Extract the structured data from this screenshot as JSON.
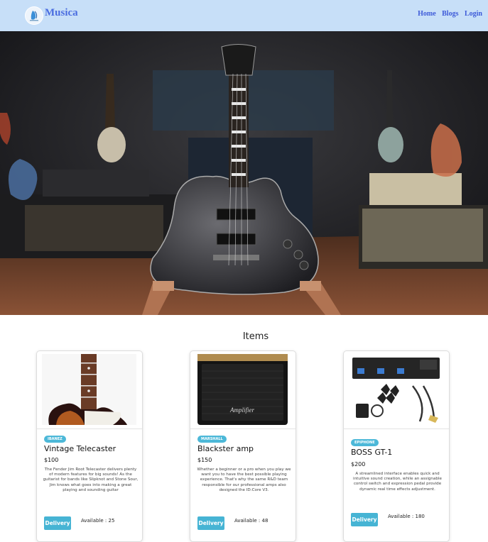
{
  "nav": {
    "brand": "Musica",
    "links": [
      "Home",
      "Blogs",
      "Login"
    ]
  },
  "items_title": "Items",
  "cards": [
    {
      "badge": "IBANEZ",
      "name": "Vintage Telecaster",
      "price": "$100",
      "description": "The Fender Jim Root Telecaster delivers plenty of modern features for big sounds! As the guitarist for bands like Slipknot and Stone Sour, Jim knows what goes into making a great playing and sounding guitar",
      "button": "Delivery",
      "available": "Available : 25"
    },
    {
      "badge": "MARSHALL",
      "name": "Blackster amp",
      "price": "$150",
      "description": "Whether a beginner or a pro when you play we want you to have the best possible playing experience. That's why the same R&D team responsible for our professional amps also designed the ID:Core V3.",
      "button": "Delivery",
      "available": "Available : 48"
    },
    {
      "badge": "EPIPHONE",
      "name": "BOSS GT-1",
      "price": "$200",
      "description": "A streamlined interface enables quick and intuitive sound creation, while an assignable control switch and expression pedal provide dynamic real time effects adjustment.",
      "button": "Delivery",
      "available": "Available : 180"
    }
  ],
  "colors": {
    "navbar": "#c7dff8",
    "brand": "#4a6de0",
    "badge": "#4cb8d8",
    "button": "#46b4d4"
  }
}
